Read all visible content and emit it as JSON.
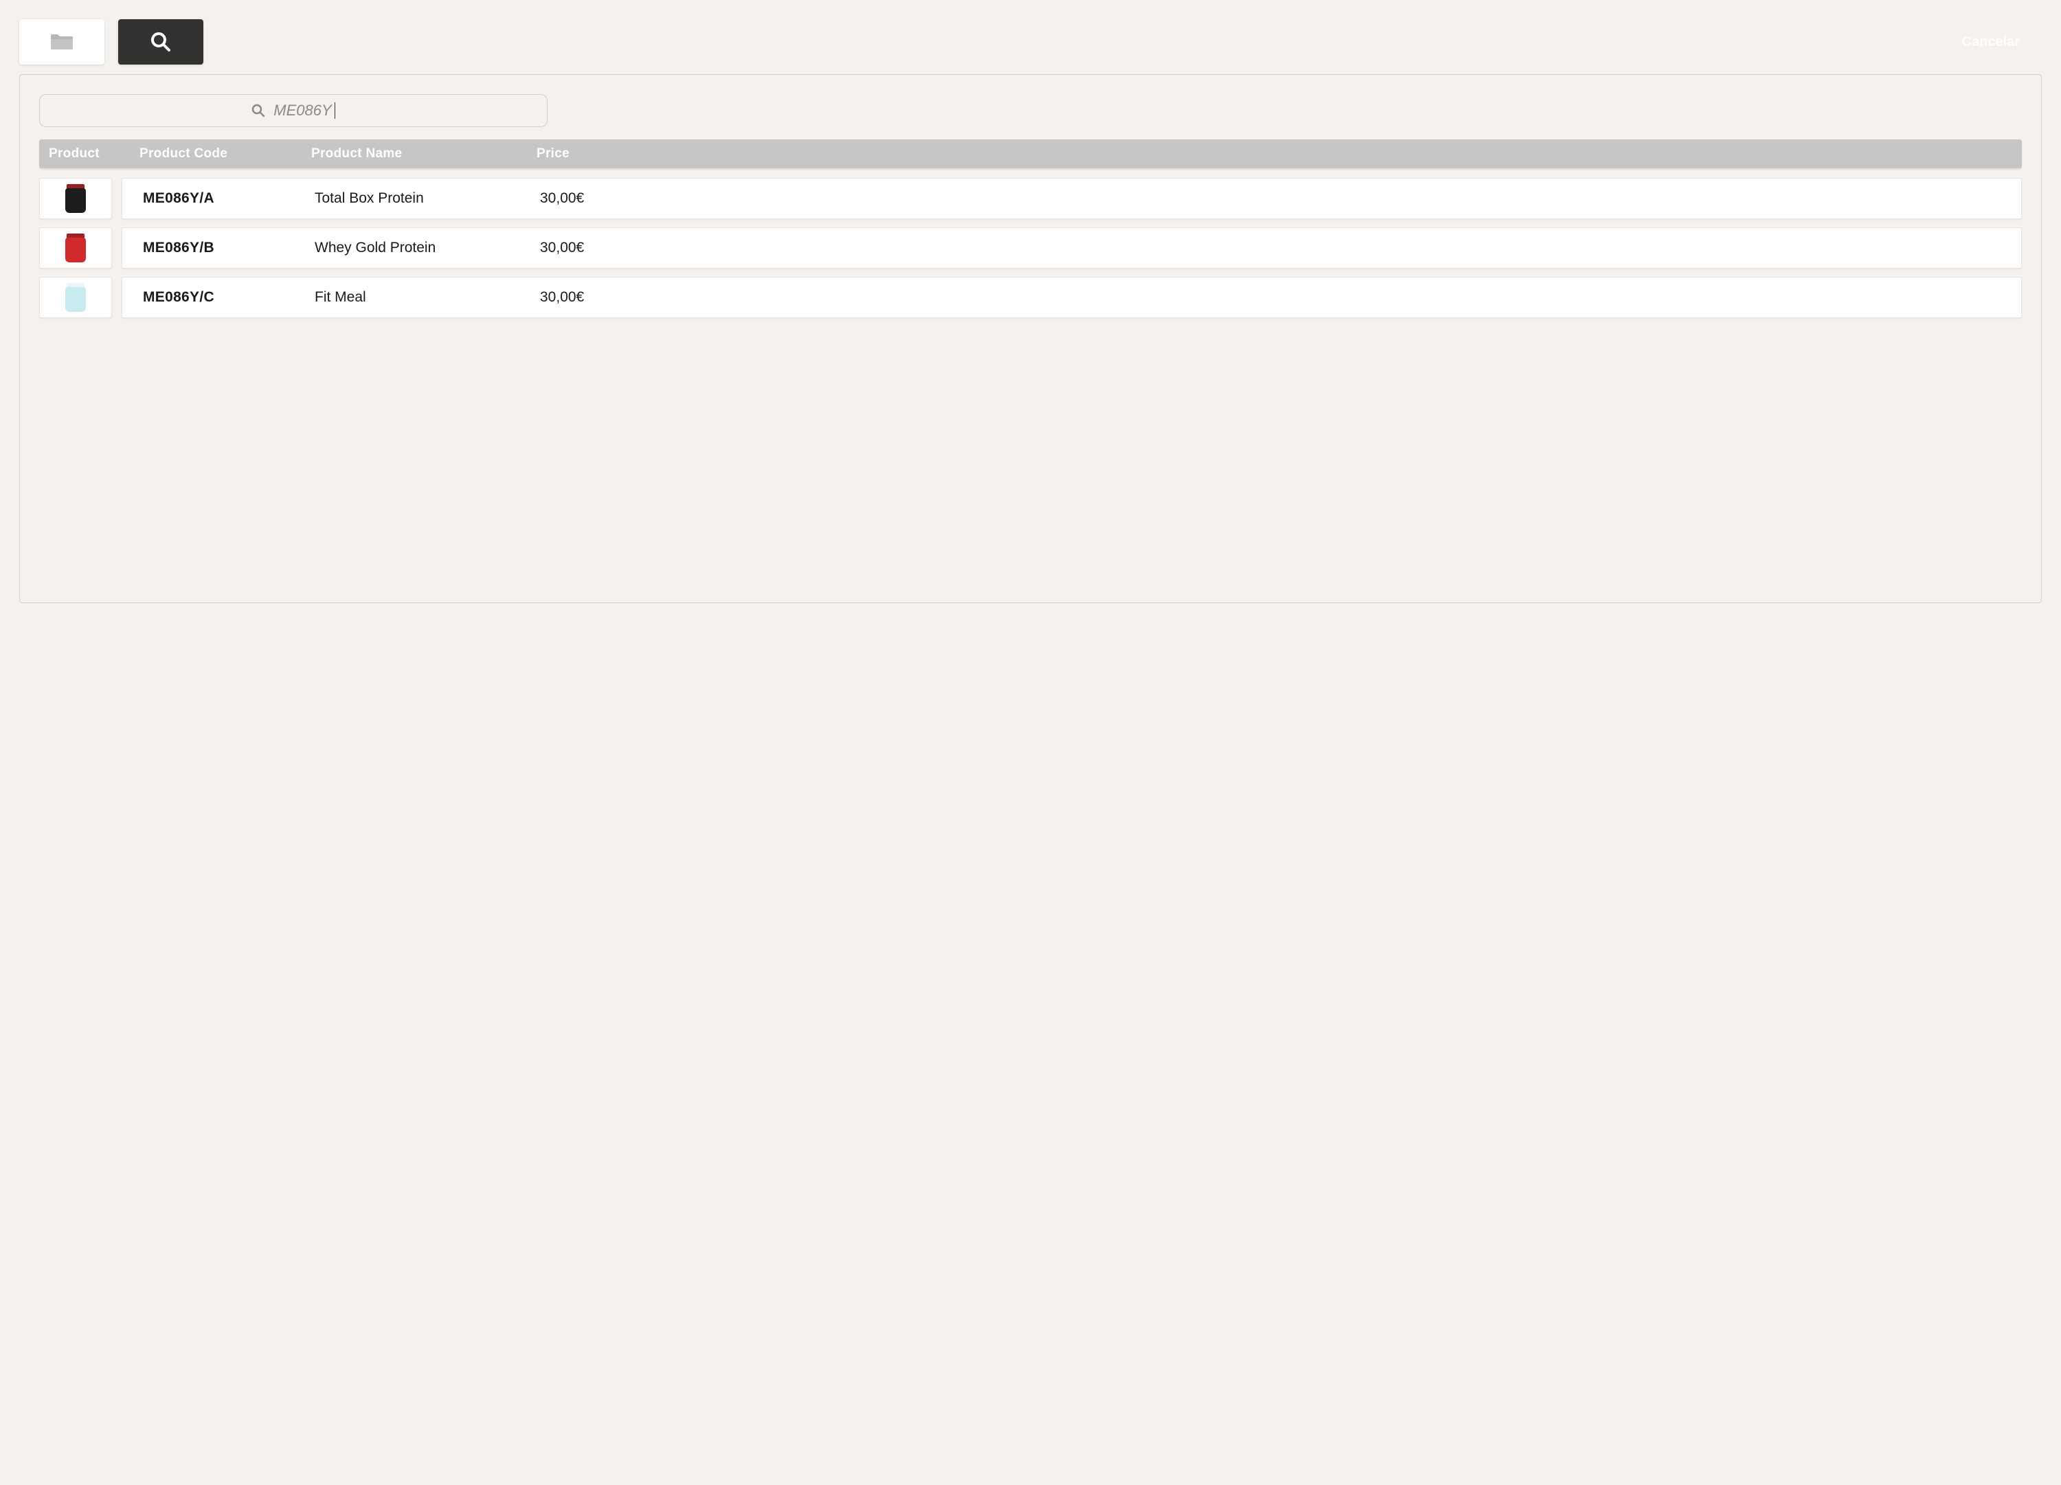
{
  "header": {
    "cancel_label": "Cancelar"
  },
  "search": {
    "value": "ME086Y"
  },
  "table": {
    "columns": {
      "product": "Product",
      "code": "Product Code",
      "name": "Product Name",
      "price": "Price"
    },
    "rows": [
      {
        "code": "ME086Y/A",
        "name": "Total Box Protein",
        "price": "30,00€",
        "thumb_body": "#1c1c1c",
        "thumb_top": "#9c1d1d"
      },
      {
        "code": "ME086Y/B",
        "name": "Whey Gold Protein",
        "price": "30,00€",
        "thumb_body": "#d12a2a",
        "thumb_top": "#a51f1f"
      },
      {
        "code": "ME086Y/C",
        "name": "Fit Meal",
        "price": "30,00€",
        "thumb_body": "#c7ecf0",
        "thumb_top": "#e9f7f8"
      }
    ]
  }
}
